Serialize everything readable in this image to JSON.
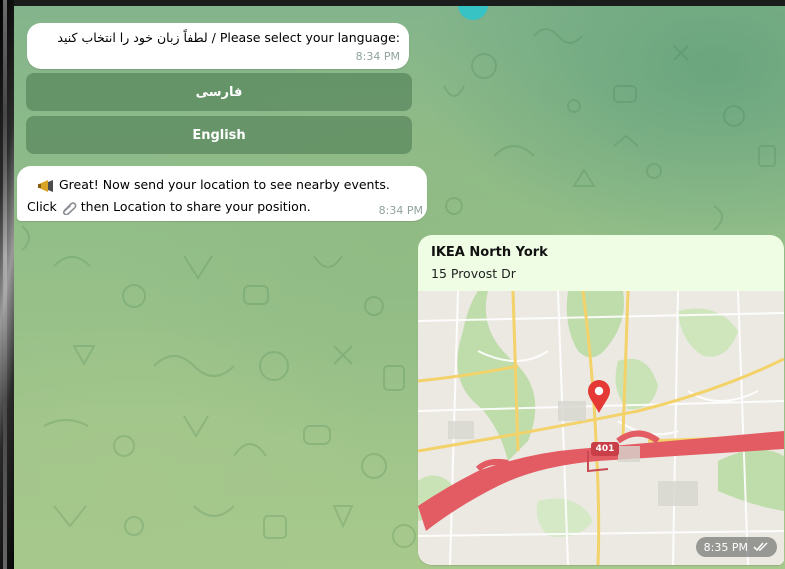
{
  "language_prompt": {
    "text": "لطفاً زبان خود را انتخاب کنید / Please select your language:",
    "time": "8:34 PM"
  },
  "language_buttons": [
    {
      "label": "فارسی"
    },
    {
      "label": "English"
    }
  ],
  "instruction": {
    "line1": "Great! Now send your location to see nearby events.",
    "line2_part1": "Click",
    "line2_part2": "then Location to share your position.",
    "time": "8:34 PM",
    "icons": [
      "megaphone-icon",
      "paperclip-icon"
    ]
  },
  "location": {
    "title": "IKEA North York",
    "address": "15 Provost Dr",
    "highway_label": "401",
    "time": "8:35 PM",
    "status_icon": "double-check-icon"
  },
  "colors": {
    "bubble": "#ffffff",
    "outgoing_bubble": "#effde4",
    "keyboard_button": "#5c8a60",
    "highway": "#e35b63",
    "pin": "#e53935",
    "timestamp": "#8fa39a"
  }
}
